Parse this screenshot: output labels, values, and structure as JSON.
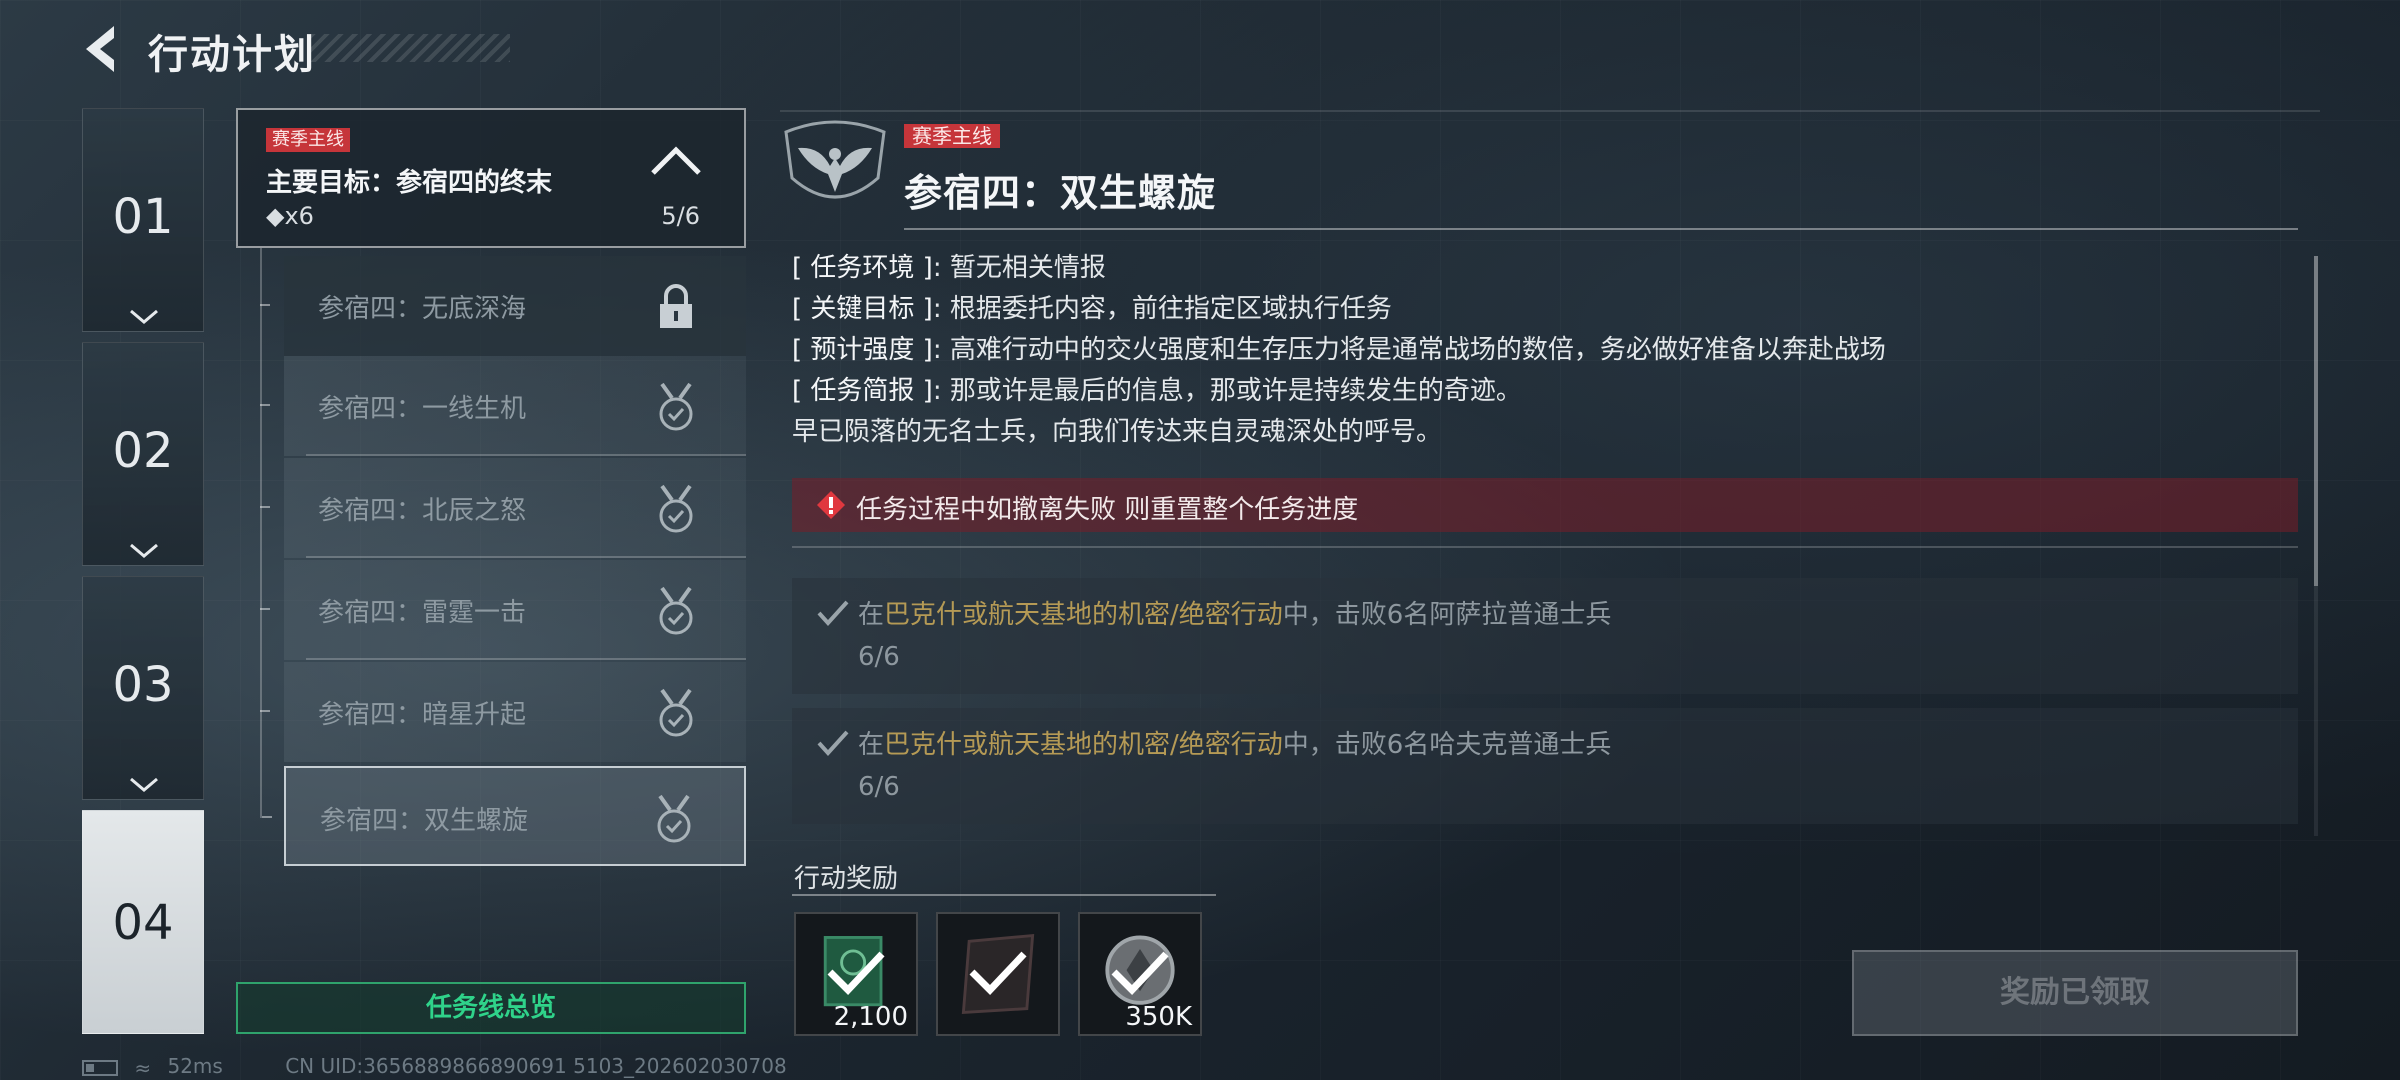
{
  "header": {
    "title": "行动计划"
  },
  "chapters": [
    {
      "num": "01"
    },
    {
      "num": "02"
    },
    {
      "num": "03"
    },
    {
      "num": "04"
    }
  ],
  "main_quest": {
    "tag": "赛季主线",
    "title": "主要目标：参宿四的终末",
    "count": "◆x6",
    "progress": "5/6"
  },
  "subquests": [
    {
      "label": "参宿四：无底深海",
      "status": "locked"
    },
    {
      "label": "参宿四：一线生机",
      "status": "completed"
    },
    {
      "label": "参宿四：北辰之怒",
      "status": "completed"
    },
    {
      "label": "参宿四：雷霆一击",
      "status": "completed"
    },
    {
      "label": "参宿四：暗星升起",
      "status": "completed"
    },
    {
      "label": "参宿四：双生螺旋",
      "status": "completed"
    }
  ],
  "overview_button": "任务线总览",
  "status_bar": {
    "ping": "52ms",
    "uid": "CN UID:3656889866890691 5103_202602030708"
  },
  "detail": {
    "tag": "赛季主线",
    "title": "参宿四：双生螺旋",
    "info": [
      {
        "key": "[ 任务环境 ]",
        "value": ": 暂无相关情报"
      },
      {
        "key": "[ 关键目标 ]",
        "value": ": 根据委托内容，前往指定区域执行任务"
      },
      {
        "key": "[ 预计强度 ]",
        "value": ": 高难行动中的交火强度和生存压力将是通常战场的数倍，务必做好准备以奔赴战场"
      },
      {
        "key": "[ 任务简报 ]",
        "value": ": 那或许是最后的信息，那或许是持续发生的奇迹。"
      }
    ],
    "info_extra": "早已陨落的无名士兵，向我们传达来自灵魂深处的呼号。",
    "warning": "任务过程中如撤离失败 则重置整个任务进度",
    "objectives": [
      {
        "prefix": "在",
        "highlight": "巴克什或航天基地的机密/绝密行动",
        "suffix": "中，击败6名阿萨拉普通士兵",
        "progress": "6/6"
      },
      {
        "prefix": "在",
        "highlight": "巴克什或航天基地的机密/绝密行动",
        "suffix": "中，击败6名哈夫克普通士兵",
        "progress": "6/6"
      }
    ]
  },
  "rewards": {
    "label": "行动奖励",
    "items": [
      {
        "qty": "2,100",
        "icon": "currency-icon"
      },
      {
        "qty": "",
        "icon": "item-icon"
      },
      {
        "qty": "350K",
        "icon": "coin-icon"
      }
    ]
  },
  "claimed_button": "奖励已领取",
  "colors": {
    "accent_red": "#c6353a",
    "accent_green": "#2fd38a",
    "highlight_gold": "#b59a55"
  }
}
